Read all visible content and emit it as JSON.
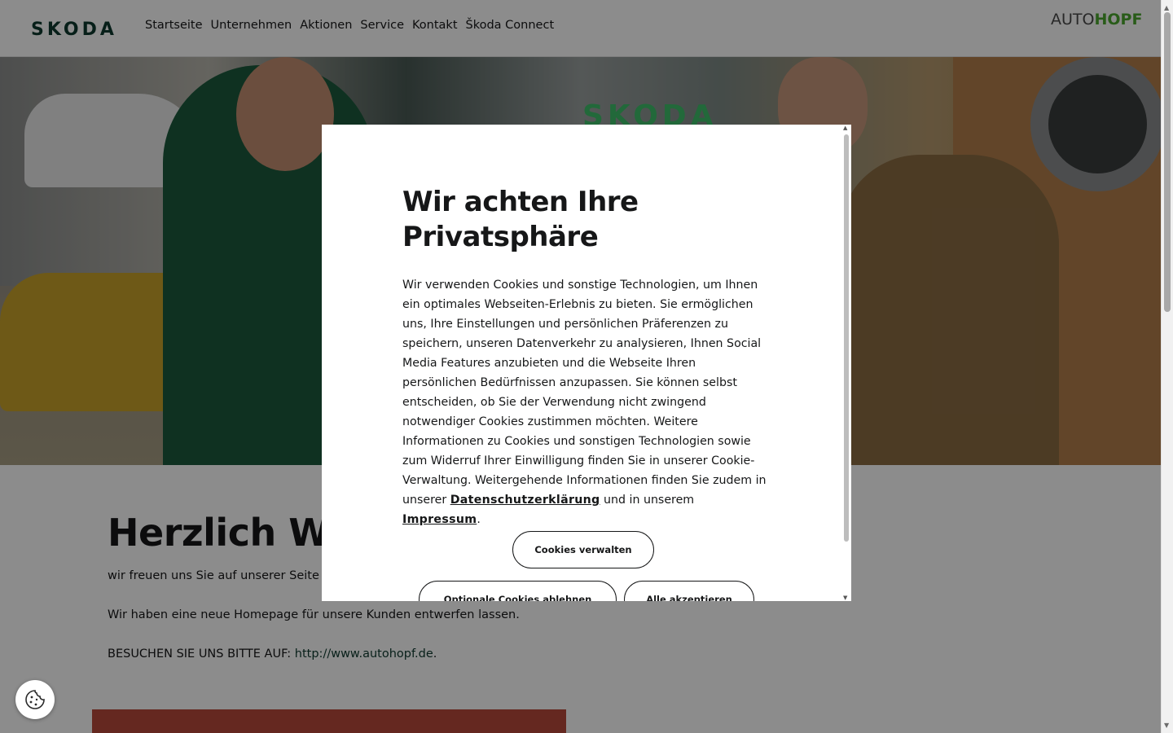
{
  "header": {
    "brand_logo": "SKODA",
    "nav": [
      "Startseite",
      "Unternehmen",
      "Aktionen",
      "Service",
      "Kontakt",
      "Škoda Connect"
    ],
    "dealer_logo_prefix": "AUTO",
    "dealer_logo_suffix": "HOPF"
  },
  "hero": {
    "sign_text": "SKODA"
  },
  "main": {
    "title": "Herzlich Willkommen",
    "paragraph1": "wir freuen uns Sie auf unserer Seite begrüßen zu dürfen.",
    "paragraph2": "Wir haben eine neue Homepage für unsere Kunden entwerfen lassen.",
    "paragraph3_prefix": "BESUCHEN SIE UNS BITTE AUF: ",
    "paragraph3_link": "http://www.autohopf.de",
    "paragraph3_suffix": "."
  },
  "cookie_modal": {
    "title": "Wir achten Ihre Privatsphäre",
    "body": "Wir verwenden Cookies und sonstige Technologien, um Ihnen ein optimales Webseiten-Erlebnis zu bieten. Sie ermöglichen uns, Ihre Einstellungen und persönlichen Präferenzen zu speichern, unseren Datenverkehr zu analysieren, Ihnen Social Media Features anzubieten und die Webseite Ihren persönlichen Bedürfnissen anzupassen. Sie können selbst entscheiden, ob Sie der Verwendung nicht zwingend notwendiger Cookies zustimmen möchten. Weitere Informationen zu Cookies und sonstigen Technologien sowie zum Widerruf Ihrer Einwilligung finden Sie in unserer Cookie-Verwaltung. Weitergehende Informationen finden Sie zudem in unserer ",
    "privacy_link": "Datenschutzerklärung",
    "middle": " und in unserem ",
    "imprint_link": "Impressum",
    "end": ".",
    "manage_button": "Cookies verwalten",
    "decline_button": "Optionale Cookies ablehnen",
    "accept_button": "Alle akzeptieren"
  },
  "icons": {
    "cookie_settings": "cookie-icon"
  },
  "colors": {
    "brand_green": "#0e3a2f",
    "dealer_green": "#4ba82e",
    "text": "#161718"
  }
}
